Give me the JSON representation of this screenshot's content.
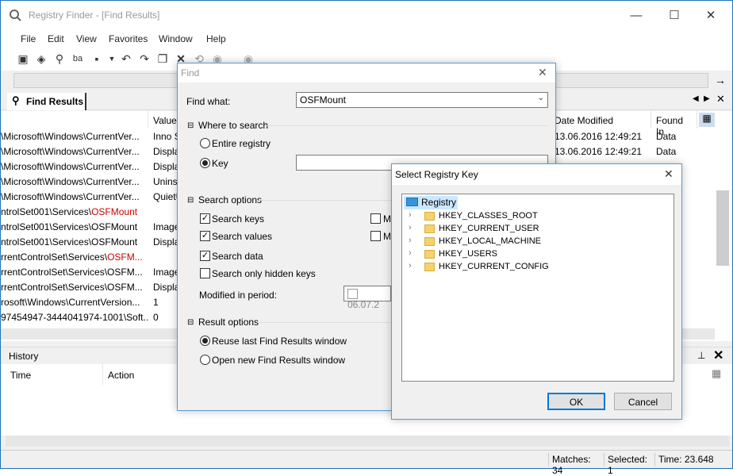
{
  "window": {
    "title": "Registry Finder - [Find Results]",
    "controls": {
      "minimize": "—",
      "maximize": "☐",
      "close": "✕"
    }
  },
  "menu": [
    "File",
    "Edit",
    "View",
    "Favorites",
    "Window",
    "Help"
  ],
  "toolbar": {
    "icons": [
      "computer-icon",
      "registry-icon",
      "find-icon",
      "replace-icon",
      "save-icon",
      "dropdown-icon",
      "undo-icon",
      "redo-icon",
      "copy-icon",
      "delete-icon",
      "refresh-icon",
      "back-icon",
      "forward-icon"
    ]
  },
  "addressbar": {
    "value": "",
    "go_icon": "→"
  },
  "tab": {
    "label": "Find Results"
  },
  "results": {
    "columns": [
      "",
      "Value",
      "Date Modified",
      "Found In"
    ],
    "rows": [
      {
        "key": "\\Microsoft\\Windows\\CurrentVer...",
        "value": "Inno S",
        "date": "13.06.2016 12:49:21",
        "found": "Data"
      },
      {
        "key": "\\Microsoft\\Windows\\CurrentVer...",
        "value": "Displa",
        "date": "13.06.2016 12:49:21",
        "found": "Data"
      },
      {
        "key": "\\Microsoft\\Windows\\CurrentVer...",
        "value": "Displa",
        "date": "",
        "found": ""
      },
      {
        "key": "\\Microsoft\\Windows\\CurrentVer...",
        "value": "Uninst",
        "date": "",
        "found": ""
      },
      {
        "key": "\\Microsoft\\Windows\\CurrentVer...",
        "value": "QuietU",
        "date": "",
        "found": ""
      },
      {
        "key_prefix": "ntrolSet001\\Services\\",
        "key_red": "OSFMount",
        "value": "",
        "date": "",
        "found": ""
      },
      {
        "key": "ntrolSet001\\Services\\OSFMount",
        "value": "Image",
        "date": "",
        "found": ""
      },
      {
        "key": "ntrolSet001\\Services\\OSFMount",
        "value": "Displa",
        "date": "",
        "found": ""
      },
      {
        "key_prefix": "rrentControlSet\\Services\\",
        "key_red": "OSFM...",
        "value": "",
        "date": "",
        "found": ""
      },
      {
        "key": "rrentControlSet\\Services\\OSFM...",
        "value": "Image",
        "date": "",
        "found": ""
      },
      {
        "key": "rrentControlSet\\Services\\OSFM...",
        "value": "Displa",
        "date": "",
        "found": ""
      },
      {
        "key": "rosoft\\Windows\\CurrentVersion...",
        "value": "1",
        "date": "",
        "found": ""
      },
      {
        "key": "97454947-3444041974-1001\\Soft...",
        "value": "0",
        "date": "",
        "found": ""
      }
    ]
  },
  "history": {
    "title": "History",
    "columns": [
      "Time",
      "Action"
    ]
  },
  "status": {
    "matches": "Matches: 34",
    "selected": "Selected: 1",
    "time": "Time: 23.648"
  },
  "find_dialog": {
    "title": "Find",
    "find_what_label": "Find what:",
    "find_what_value": "OSFMount",
    "where_label": "Where to search",
    "entire_registry": "Entire registry",
    "key_label": "Key",
    "key_value": "",
    "search_options_label": "Search options",
    "search_keys": "Search keys",
    "search_values": "Search values",
    "search_data": "Search data",
    "hidden_keys": "Search only hidden keys",
    "match1": "Ma",
    "match2": "Ma",
    "modified_label": "Modified in period:",
    "modified_value": "06.07.2",
    "result_options_label": "Result options",
    "reuse": "Reuse last Find Results window",
    "open_new": "Open new Find Results window"
  },
  "select_key_dialog": {
    "title": "Select Registry Key",
    "root": "Registry",
    "hives": [
      "HKEY_CLASSES_ROOT",
      "HKEY_CURRENT_USER",
      "HKEY_LOCAL_MACHINE",
      "HKEY_USERS",
      "HKEY_CURRENT_CONFIG"
    ],
    "ok": "OK",
    "cancel": "Cancel"
  }
}
